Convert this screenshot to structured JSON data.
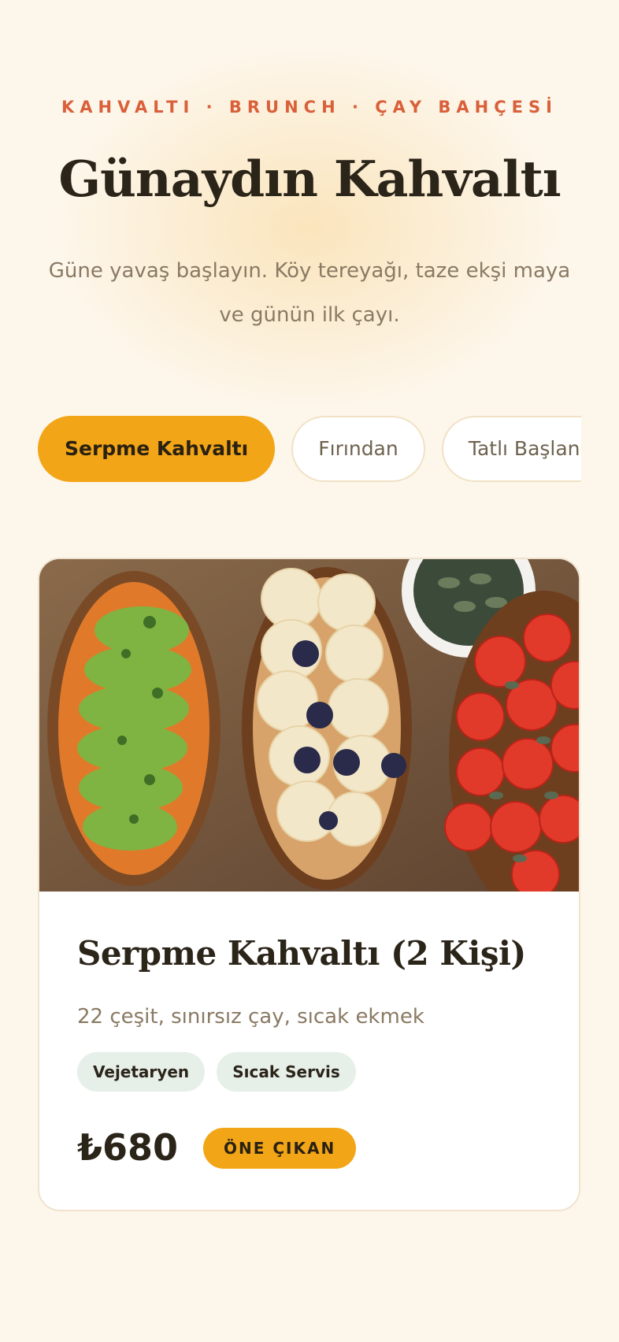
{
  "header": {
    "eyebrow": "KAHVALTI · BRUNCH · ÇAY BAHÇESİ",
    "title": "Günaydın Kahvaltı",
    "subtitle": "Güne yavaş başlayın. Köy tereyağı, taze ekşi maya ve günün ilk çayı."
  },
  "tabs": [
    {
      "label": "Serpme Kahvaltı",
      "active": true
    },
    {
      "label": "Fırından",
      "active": false
    },
    {
      "label": "Tatlı Başlangıçlar",
      "active": false
    }
  ],
  "card": {
    "title": "Serpme Kahvaltı (2 Kişi)",
    "description": "22 çeşit, sınırsız çay, sıcak ekmek",
    "tags": [
      "Vejetaryen",
      "Sıcak Servis"
    ],
    "price": "₺680",
    "badge": "ÖNE ÇIKAN"
  },
  "colors": {
    "background": "#fdf6ea",
    "accent": "#f2a516",
    "eyebrow": "#d9603a",
    "tag_bg": "#e6efe8"
  }
}
